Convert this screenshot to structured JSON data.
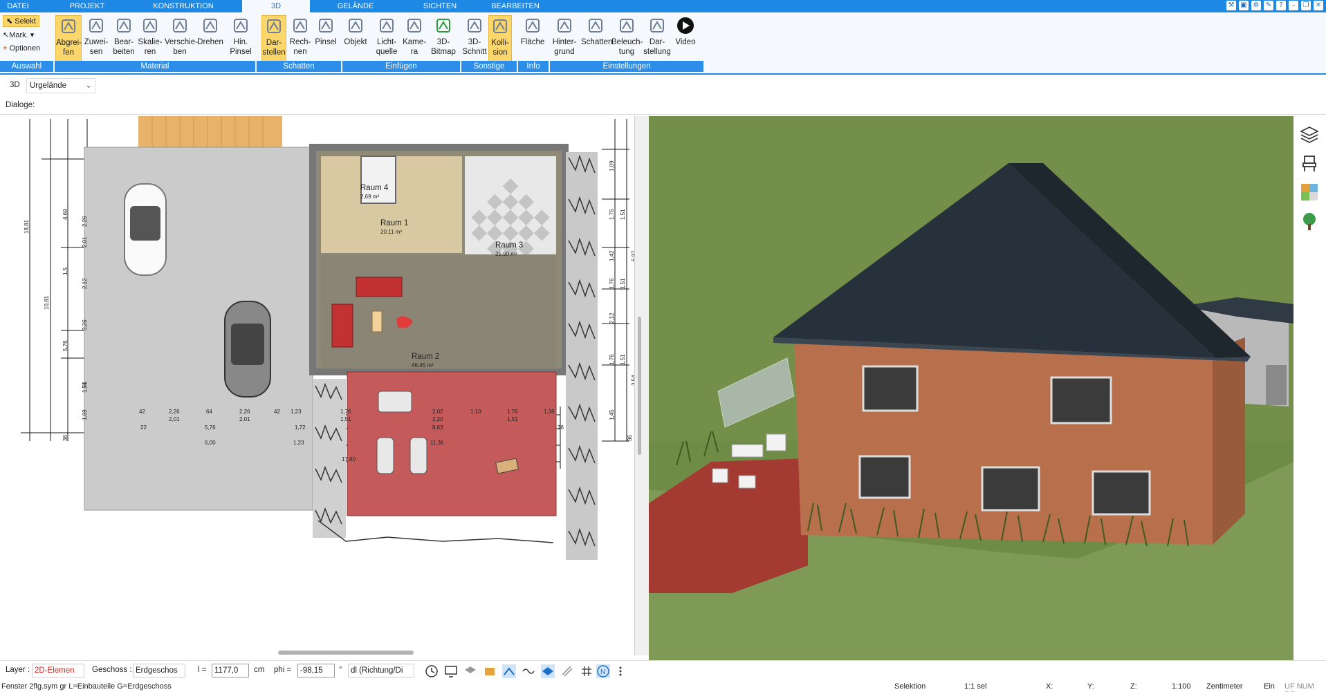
{
  "menu": {
    "tabs": [
      "DATEI",
      "PROJEKT",
      "KONSTRUKTION",
      "3D",
      "GELÄNDE",
      "SICHTEN",
      "BEARBEITEN"
    ]
  },
  "ribbon": {
    "side": {
      "select": "Selekt",
      "mark": "Mark.",
      "options": "Optionen"
    },
    "buttons": [
      {
        "l1": "Abgrei-",
        "l2": "fen"
      },
      {
        "l1": "Zuwei-",
        "l2": "sen"
      },
      {
        "l1": "Bear-",
        "l2": "beiten"
      },
      {
        "l1": "Skalie-",
        "l2": "ren"
      },
      {
        "l1": "Verschie-",
        "l2": "ben"
      },
      {
        "l1": "Drehen",
        "l2": ""
      },
      {
        "l1": "Hin.",
        "l2": "Pinsel"
      },
      {
        "l1": "Dar-",
        "l2": "stellen"
      },
      {
        "l1": "Rech-",
        "l2": "nen"
      },
      {
        "l1": "Pinsel",
        "l2": ""
      },
      {
        "l1": "Objekt",
        "l2": ""
      },
      {
        "l1": "Licht-",
        "l2": "quelle"
      },
      {
        "l1": "Kame-",
        "l2": "ra"
      },
      {
        "l1": "3D-",
        "l2": "Bitmap"
      },
      {
        "l1": "3D-",
        "l2": "Schnitt"
      },
      {
        "l1": "Kolli-",
        "l2": "sion"
      },
      {
        "l1": "Fläche",
        "l2": ""
      },
      {
        "l1": "Hinter-",
        "l2": "grund"
      },
      {
        "l1": "Schatten",
        "l2": ""
      },
      {
        "l1": "Beleuch-",
        "l2": "tung"
      },
      {
        "l1": "Dar-",
        "l2": "stellung"
      },
      {
        "l1": "Video",
        "l2": ""
      }
    ],
    "groups": [
      "Auswahl",
      "Material",
      "Schatten",
      "Einfügen",
      "Sonstige",
      "Info",
      "Einstellungen"
    ]
  },
  "view_toolbar": {
    "mode": "3D",
    "terrain_select": "Urgelände"
  },
  "dialog_row": {
    "label": "Dialoge:"
  },
  "plan": {
    "rooms": [
      {
        "name": "Raum 4",
        "area": "2,69 m²"
      },
      {
        "name": "Raum 1",
        "area": "20,11 m²"
      },
      {
        "name": "Raum 3",
        "area": "25,90 m²"
      },
      {
        "name": "Raum 2",
        "area": "46,45 m²"
      }
    ],
    "dims_left": [
      "18,81",
      "10,81",
      "4,69",
      "5,76",
      "2,01",
      "2,26",
      "1,5",
      "3,26",
      "1,76",
      "1,51",
      "1,69",
      "2,12",
      "36"
    ],
    "dims_right": [
      "1,09",
      "1,76",
      "1,51",
      "6,97",
      "1,42",
      "1,76",
      "1,51",
      "2,12",
      "1,76",
      "1,51",
      "3,54",
      "1,45",
      "36"
    ],
    "dims_bottom_row1": [
      "42",
      "2,26",
      "64",
      "2,26",
      "42",
      "1,23",
      "1,76",
      "2,02",
      "1,10",
      "1,76",
      "1,36"
    ],
    "dims_bottom_row1b": [
      "2,01",
      "2,01",
      "1,51",
      "2,20",
      "1,51"
    ],
    "dims_bottom_row2": [
      "22",
      "5,76",
      "1,72",
      "8,63",
      "36"
    ],
    "dims_bottom_row3": [
      "6,00",
      "1,23",
      "11,36"
    ],
    "dims_bottom_row4": [
      "17,60"
    ]
  },
  "status": {
    "layer_label": "Layer :",
    "layer_value": "2D-Elemen",
    "floor_label": "Geschoss :",
    "floor_value": "Erdgeschos",
    "l_label": "l =",
    "l_value": "1177,0",
    "l_unit": "cm",
    "phi_label": "phi =",
    "phi_value": "-98,15",
    "phi_unit": "°",
    "dl_value": "dl (Richtung/Di"
  },
  "footer": {
    "file": "Fenster 2flg.sym gr L=Einbauteile G=Erdgeschoss",
    "mode": "Selektion",
    "sel": "1:1 sel",
    "x": "X:",
    "y": "Y:",
    "z": "Z:",
    "scale": "1:100",
    "unit": "Zentimeter",
    "on": "Ein",
    "flags": "UF NUM RF"
  },
  "colors": {
    "accent": "#1e88e5",
    "active": "#fbd66a",
    "paving": "#c8c8c8",
    "terrace": "#c55a5a",
    "grass": "#738f4b",
    "roof": "#2b3540",
    "wall": "#b56c4a"
  },
  "icons": [
    "select-icon",
    "mark-icon",
    "options-icon",
    "layers-icon",
    "chair-icon",
    "material-icon",
    "tree-icon",
    "clock-icon",
    "grid-icon",
    "north-icon"
  ]
}
